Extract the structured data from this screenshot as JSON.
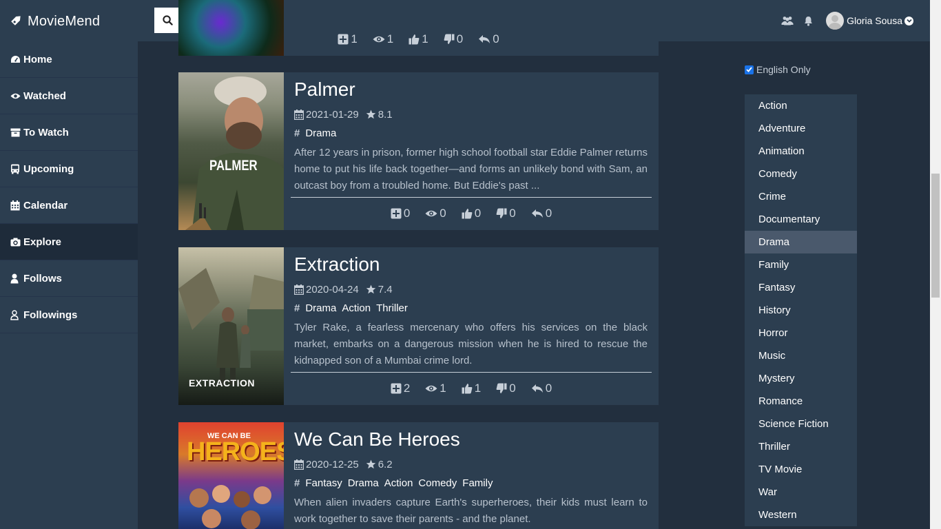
{
  "app": {
    "name": "MovieMend"
  },
  "search": {
    "placeholder": "Search..."
  },
  "user": {
    "name": "Gloria Sousa"
  },
  "sidebar": {
    "items": [
      {
        "label": "Home",
        "icon": "dashboard-icon"
      },
      {
        "label": "Watched",
        "icon": "eye-icon"
      },
      {
        "label": "To Watch",
        "icon": "archive-icon"
      },
      {
        "label": "Upcoming",
        "icon": "bus-icon"
      },
      {
        "label": "Calendar",
        "icon": "calendar-icon"
      },
      {
        "label": "Explore",
        "icon": "camera-icon",
        "active": true
      },
      {
        "label": "Follows",
        "icon": "user-icon"
      },
      {
        "label": "Followings",
        "icon": "user-outline-icon"
      }
    ]
  },
  "previous_card": {
    "stats": [
      "1",
      "1",
      "1",
      "0",
      "0"
    ]
  },
  "movies": [
    {
      "title": "Palmer",
      "date": "2021-01-29",
      "rating": "8.1",
      "genres": [
        "Drama"
      ],
      "overview": "After 12 years in prison, former high school football star Eddie Palmer returns home to put his life back together—and forms an unlikely bond with Sam, an outcast boy from a troubled home. But Eddie's past ...",
      "poster_text": "PALMER",
      "stats": {
        "add": "0",
        "views": "0",
        "likes": "0",
        "dislikes": "0",
        "replies": "0"
      }
    },
    {
      "title": "Extraction",
      "date": "2020-04-24",
      "rating": "7.4",
      "genres": [
        "Drama",
        "Action",
        "Thriller"
      ],
      "overview": "Tyler Rake, a fearless mercenary who offers his services on the black market, embarks on a dangerous mission when he is hired to rescue the kidnapped son of a Mumbai crime lord.",
      "poster_text": "EXTRACTION",
      "stats": {
        "add": "2",
        "views": "1",
        "likes": "1",
        "dislikes": "0",
        "replies": "0"
      }
    },
    {
      "title": "We Can Be Heroes",
      "date": "2020-12-25",
      "rating": "6.2",
      "genres": [
        "Fantasy",
        "Drama",
        "Action",
        "Comedy",
        "Family"
      ],
      "overview": "When alien invaders capture Earth's superheroes, their kids must learn to work together to save their parents - and the planet.",
      "poster_text_top": "WE CAN BE",
      "poster_text_main": "HEROES"
    }
  ],
  "filters": {
    "english_only_label": "English Only",
    "english_only_checked": true,
    "genres": [
      "Action",
      "Adventure",
      "Animation",
      "Comedy",
      "Crime",
      "Documentary",
      "Drama",
      "Family",
      "Fantasy",
      "History",
      "Horror",
      "Music",
      "Mystery",
      "Romance",
      "Science Fiction",
      "Thriller",
      "TV Movie",
      "War",
      "Western"
    ],
    "selected_genre": "Drama"
  },
  "colors": {
    "topbar": "#2c3e50",
    "background": "#222f3e",
    "selected_genre": "#4a596c"
  }
}
